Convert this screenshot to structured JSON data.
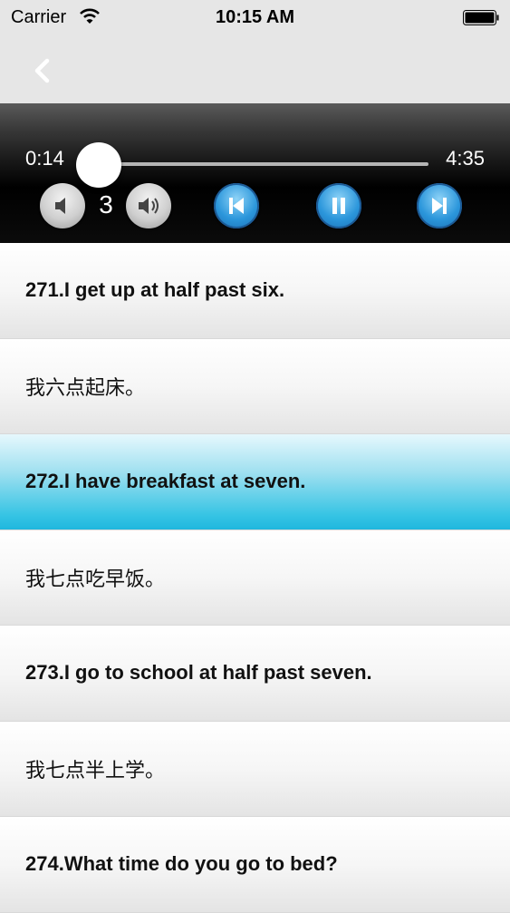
{
  "status_bar": {
    "carrier": "Carrier",
    "time": "10:15 AM"
  },
  "nav": {
    "back_icon": "chevron-left-icon"
  },
  "player": {
    "current_time": "0:14",
    "total_time": "4:35",
    "progress": 0.05,
    "volume_level": "3",
    "icons": [
      "volume-down-icon",
      "volume-up-icon",
      "skip-previous-icon",
      "pause-icon",
      "skip-next-icon"
    ]
  },
  "sentences": [
    {
      "text": "271.I get up at half past six.",
      "selected": false,
      "lang": "en"
    },
    {
      "text": "我六点起床。",
      "selected": false,
      "lang": "zh"
    },
    {
      "text": "272.I have breakfast at seven.",
      "selected": true,
      "lang": "en"
    },
    {
      "text": "我七点吃早饭。",
      "selected": false,
      "lang": "zh"
    },
    {
      "text": "273.I go to school at half past seven.",
      "selected": false,
      "lang": "en"
    },
    {
      "text": "我七点半上学。",
      "selected": false,
      "lang": "zh"
    },
    {
      "text": "274.What time do you go to bed?",
      "selected": false,
      "lang": "en"
    }
  ],
  "colors": {
    "accent": "#1aa2e6",
    "selected_row": "#1fb7de"
  }
}
